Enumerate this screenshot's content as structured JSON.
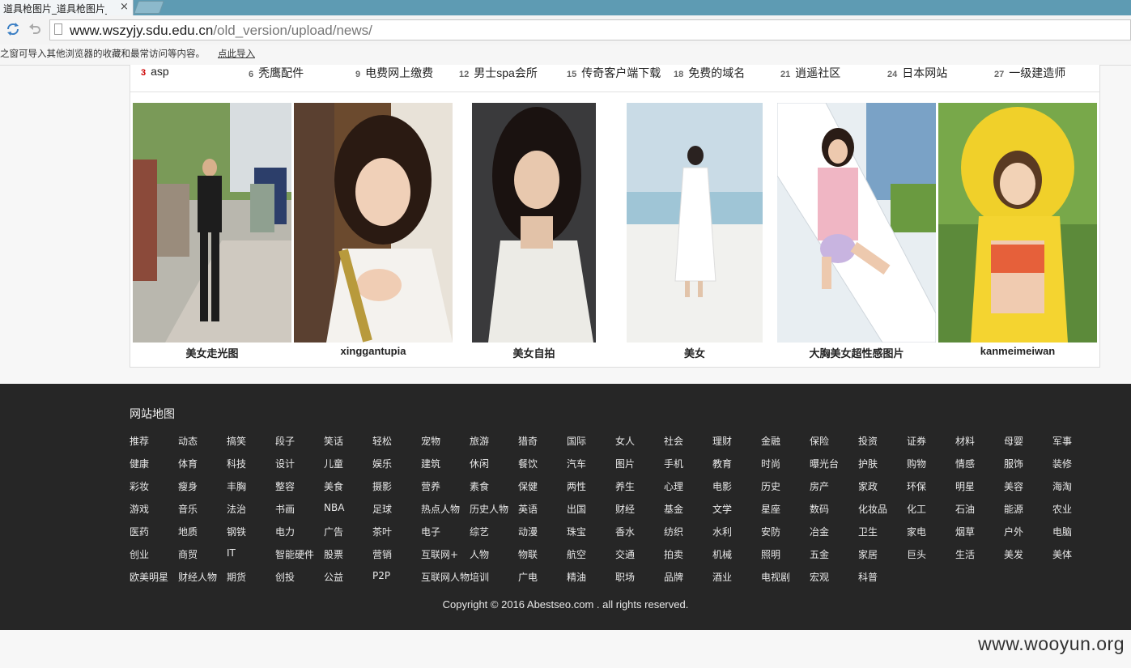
{
  "browser": {
    "tab_title": "道具枪图片_道具枪图片_",
    "tab_close": "×",
    "url_host": "www.wszyjy.sdu.edu.cn",
    "url_path": "/old_version/upload/news/",
    "bookmark_notice": "之窗可导入其他浏览器的收藏和最常访问等内容。",
    "bookmark_import_link": "点此导入"
  },
  "links": [
    {
      "num": "3",
      "label": "asp"
    },
    {
      "num": "6",
      "label": "秃鹰配件"
    },
    {
      "num": "9",
      "label": "电费网上缴费"
    },
    {
      "num": "12",
      "label": "男士spa会所"
    },
    {
      "num": "15",
      "label": "传奇客户端下载"
    },
    {
      "num": "18",
      "label": "免费的域名"
    },
    {
      "num": "21",
      "label": "逍遥社区"
    },
    {
      "num": "24",
      "label": "日本网站"
    },
    {
      "num": "27",
      "label": "一级建造师"
    }
  ],
  "photos": [
    {
      "caption": "美女走光图"
    },
    {
      "caption": "xinggantupia"
    },
    {
      "caption": "美女自拍"
    },
    {
      "caption": "美女"
    },
    {
      "caption": "大胸美女超性感图片"
    },
    {
      "caption": "kanmeimeiwan"
    }
  ],
  "footer": {
    "title": "网站地图",
    "categories": [
      [
        "推荐",
        "动态",
        "搞笑",
        "段子",
        "笑话",
        "轻松",
        "宠物",
        "旅游",
        "猎奇",
        "国际",
        "女人",
        "社会",
        "理财",
        "金融",
        "保险",
        "投资",
        "证券",
        "材料",
        "母婴",
        "军事"
      ],
      [
        "健康",
        "体育",
        "科技",
        "设计",
        "儿童",
        "娱乐",
        "建筑",
        "休闲",
        "餐饮",
        "汽车",
        "图片",
        "手机",
        "教育",
        "时尚",
        "曝光台",
        "护肤",
        "购物",
        "情感",
        "服饰",
        "装修"
      ],
      [
        "彩妆",
        "瘦身",
        "丰胸",
        "整容",
        "美食",
        "摄影",
        "营养",
        "素食",
        "保健",
        "两性",
        "养生",
        "心理",
        "电影",
        "历史",
        "房产",
        "家政",
        "环保",
        "明星",
        "美容",
        "海淘"
      ],
      [
        "游戏",
        "音乐",
        "法治",
        "书画",
        "NBA",
        "足球",
        "热点人物",
        "历史人物",
        "英语",
        "出国",
        "财经",
        "基金",
        "文学",
        "星座",
        "数码",
        "化妆品",
        "化工",
        "石油",
        "能源",
        "农业"
      ],
      [
        "医药",
        "地质",
        "钢铁",
        "电力",
        "广告",
        "茶叶",
        "电子",
        "综艺",
        "动漫",
        "珠宝",
        "香水",
        "纺织",
        "水利",
        "安防",
        "冶金",
        "卫生",
        "家电",
        "烟草",
        "户外",
        "电脑"
      ],
      [
        "创业",
        "商贸",
        "IT",
        "智能硬件",
        "股票",
        "营销",
        "互联网+",
        "人物",
        "物联",
        "航空",
        "交通",
        "拍卖",
        "机械",
        "照明",
        "五金",
        "家居",
        "巨头",
        "生活",
        "美发",
        "美体"
      ],
      [
        "欧美明星",
        "财经人物",
        "期货",
        "创投",
        "公益",
        "P2P",
        "互联网人物培训",
        "",
        "广电",
        "精油",
        "职场",
        "品牌",
        "酒业",
        "电视剧",
        "宏观",
        "科普"
      ]
    ],
    "copyright": "Copyright © 2016 Abestseo.com . all rights reserved."
  },
  "watermark": "www.wooyun.org"
}
